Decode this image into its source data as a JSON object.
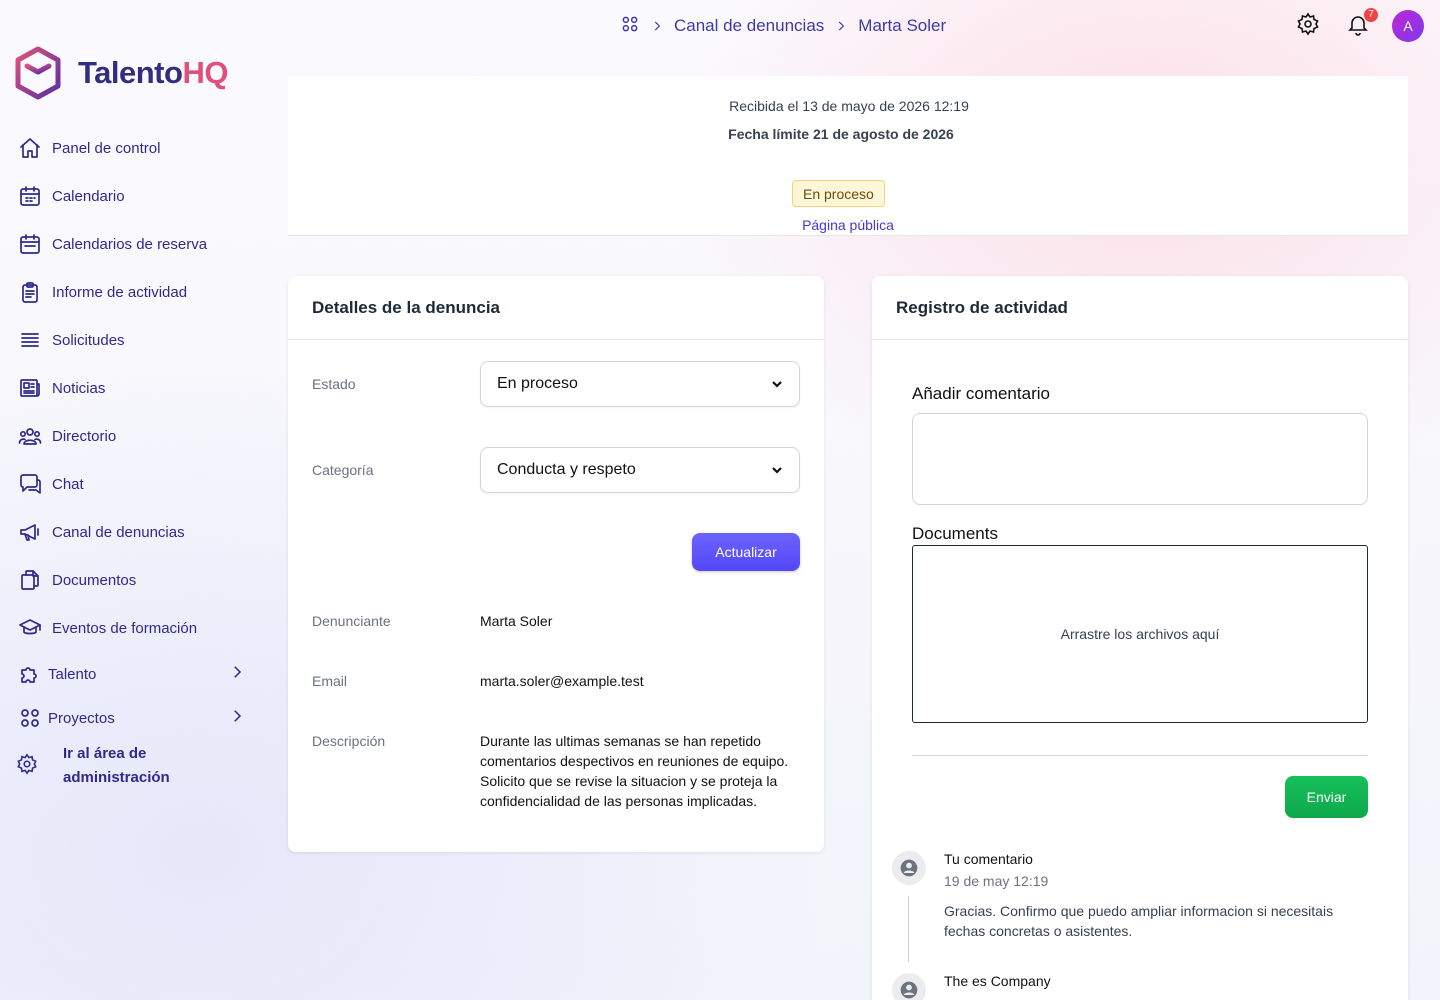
{
  "brand": {
    "name_part1": "Talento",
    "name_part2": "HQ"
  },
  "sidebar": {
    "items": [
      {
        "label": "Panel de control",
        "icon": "home-icon"
      },
      {
        "label": "Calendario",
        "icon": "calendar-icon"
      },
      {
        "label": "Calendarios de reserva",
        "icon": "booking-calendar-icon"
      },
      {
        "label": "Informe de actividad",
        "icon": "clipboard-icon"
      },
      {
        "label": "Solicitudes",
        "icon": "list-icon"
      },
      {
        "label": "Noticias",
        "icon": "newspaper-icon"
      },
      {
        "label": "Directorio",
        "icon": "users-icon"
      },
      {
        "label": "Chat",
        "icon": "chat-icon"
      },
      {
        "label": "Canal de denuncias",
        "icon": "megaphone-icon"
      },
      {
        "label": "Documentos",
        "icon": "documents-icon"
      },
      {
        "label": "Eventos de formación",
        "icon": "graduation-cap-icon"
      }
    ],
    "expandable": [
      {
        "label": "Talento",
        "icon": "puzzle-icon"
      },
      {
        "label": "Proyectos",
        "icon": "grid-icon"
      }
    ],
    "admin_label": "Ir al área de administración"
  },
  "breadcrumb": {
    "section": "Canal de denuncias",
    "current": "Marta Soler"
  },
  "topbar": {
    "notifications_count": "7",
    "avatar_initial": "A"
  },
  "header": {
    "received": "Recibida el 13 de mayo de 2026 12:19",
    "deadline": "Fecha límite 21 de agosto de 2026",
    "status": "En proceso",
    "public_link": "Página pública"
  },
  "details": {
    "title": "Detalles de la denuncia",
    "status_label": "Estado",
    "status_value": "En proceso",
    "category_label": "Categoría",
    "category_value": "Conducta y respeto",
    "update_button": "Actualizar",
    "reporter_label": "Denunciante",
    "reporter_value": "Marta Soler",
    "email_label": "Email",
    "email_value": "marta.soler@example.test",
    "description_label": "Descripción",
    "description_value": "Durante las ultimas semanas se han repetido comentarios despectivos en reuniones de equipo. Solicito que se revise la situacion y se proteja la confidencialidad de las personas implicadas."
  },
  "activity": {
    "title": "Registro de actividad",
    "comment_label": "Añadir comentario",
    "documents_label": "Documents",
    "dropzone_text": "Arrastre los archivos aquí",
    "send_button": "Enviar",
    "comments": [
      {
        "author": "Tu comentario",
        "time": "19 de may 12:19",
        "body": "Gracias. Confirmo que puedo ampliar informacion si necesitais fechas concretas o asistentes."
      },
      {
        "author": "The es Company",
        "time": "",
        "body": ""
      }
    ]
  },
  "colors": {
    "brand_primary": "#312e81",
    "brand_accent": "#e0507a",
    "primary_button": "#5b50f7",
    "send_button": "#12b553",
    "status_pill_bg": "#fdf6d7"
  }
}
